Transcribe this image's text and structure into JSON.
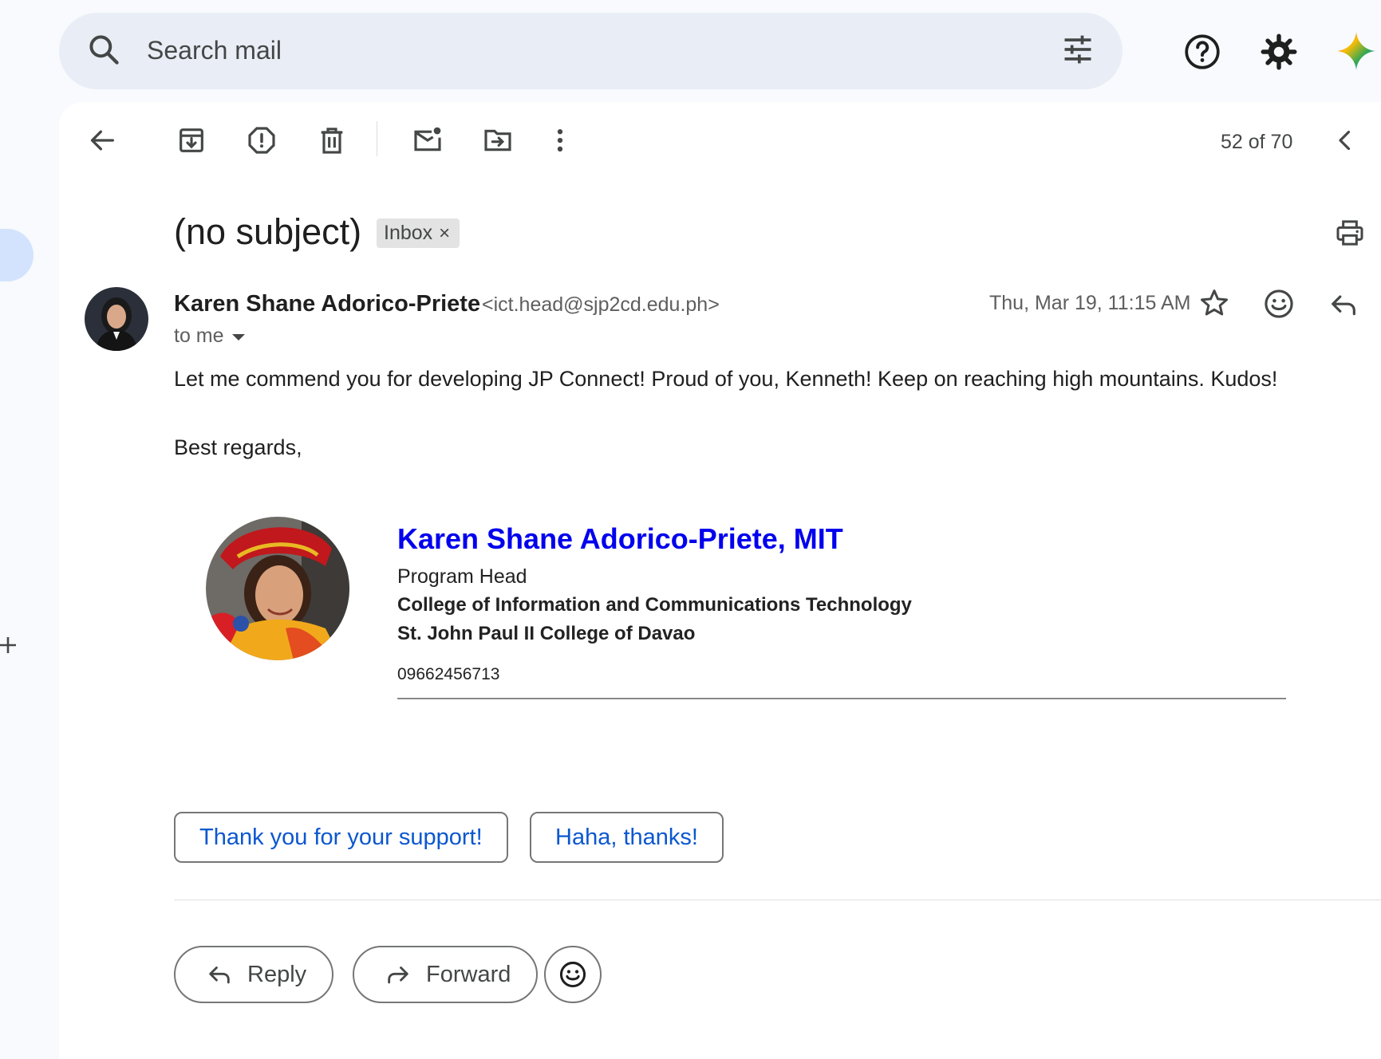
{
  "search": {
    "placeholder": "Search mail"
  },
  "toolbar": {
    "counter": "52 of 70"
  },
  "message": {
    "subject": "(no subject)",
    "label_chip": "Inbox",
    "chip_close": "×",
    "sender_name": "Karen Shane Adorico-Priete",
    "sender_email": "<ict.head@sjp2cd.edu.ph>",
    "recipient": "to me",
    "date": "Thu, Mar 19, 11:15 AM",
    "body": "Let me commend you for developing JP Connect! Proud of you, Kenneth! Keep on reaching high mountains. Kudos!",
    "closing": "Best regards,"
  },
  "signature": {
    "name": "Karen Shane Adorico-Priete, MIT",
    "title": "Program Head",
    "college": "College of Information and Communications Technology",
    "school": "St. John Paul II College of Davao",
    "phone": "09662456713"
  },
  "smart_replies": [
    "Thank you for your support!",
    "Haha, thanks!"
  ],
  "actions": {
    "reply": "Reply",
    "forward": "Forward"
  },
  "colors": {
    "accent_blue": "#0b57d0",
    "signature_link": "#0000ee",
    "active_rail": "#d3e3fd",
    "search_bg": "#e9eef6"
  },
  "icons": {
    "search": "search-icon",
    "filter": "tune-icon",
    "help": "help-icon",
    "settings": "gear-icon",
    "gemini": "gemini-sparkle-icon",
    "back": "arrow-back-icon",
    "archive": "archive-icon",
    "spam": "report-spam-icon",
    "delete": "trash-icon",
    "mark_unread": "mark-unread-icon",
    "move": "move-to-icon",
    "more": "more-vert-icon",
    "prev": "chevron-left-icon",
    "print": "print-icon",
    "star": "star-icon",
    "emoji": "emoji-icon",
    "reply": "reply-icon",
    "forward": "forward-icon",
    "compose_plus": "plus-icon"
  }
}
